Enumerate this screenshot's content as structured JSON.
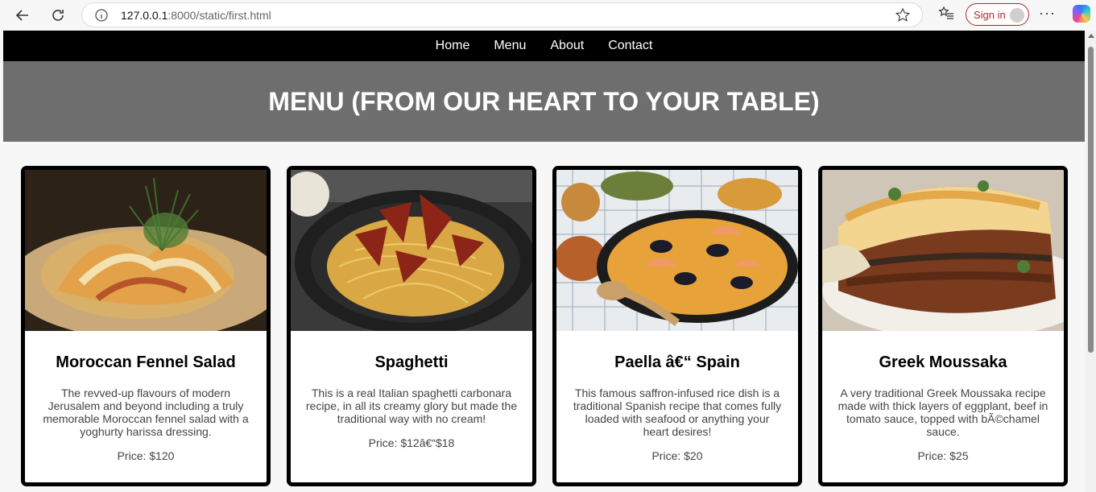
{
  "browser": {
    "url_host": "127.0.0.1",
    "url_path": ":8000/static/first.html",
    "signin_label": "Sign in"
  },
  "site": {
    "nav": [
      "Home",
      "Menu",
      "About",
      "Contact"
    ],
    "hero_title": "MENU (FROM OUR HEART TO YOUR TABLE)"
  },
  "cards": [
    {
      "title": "Moroccan Fennel Salad",
      "desc": "The revved-up flavours of modern Jerusalem and beyond including a truly memorable Moroccan fennel salad with a yoghurty harissa dressing.",
      "price": "Price: $120"
    },
    {
      "title": "Spaghetti",
      "desc": "This is a real Italian spaghetti carbonara recipe, in all its creamy glory but made the traditional way with no cream!",
      "price": "Price: $12â€“$18"
    },
    {
      "title": "Paella â€“ Spain",
      "desc": "This famous saffron-infused rice dish is a traditional Spanish recipe that comes fully loaded with seafood or anything your heart desires!",
      "price": "Price: $20"
    },
    {
      "title": "Greek Moussaka",
      "desc": "A very traditional Greek Moussaka recipe made with thick layers of eggplant, beef in tomato sauce, topped with bÃ©chamel sauce.",
      "price": "Price: $25"
    }
  ]
}
